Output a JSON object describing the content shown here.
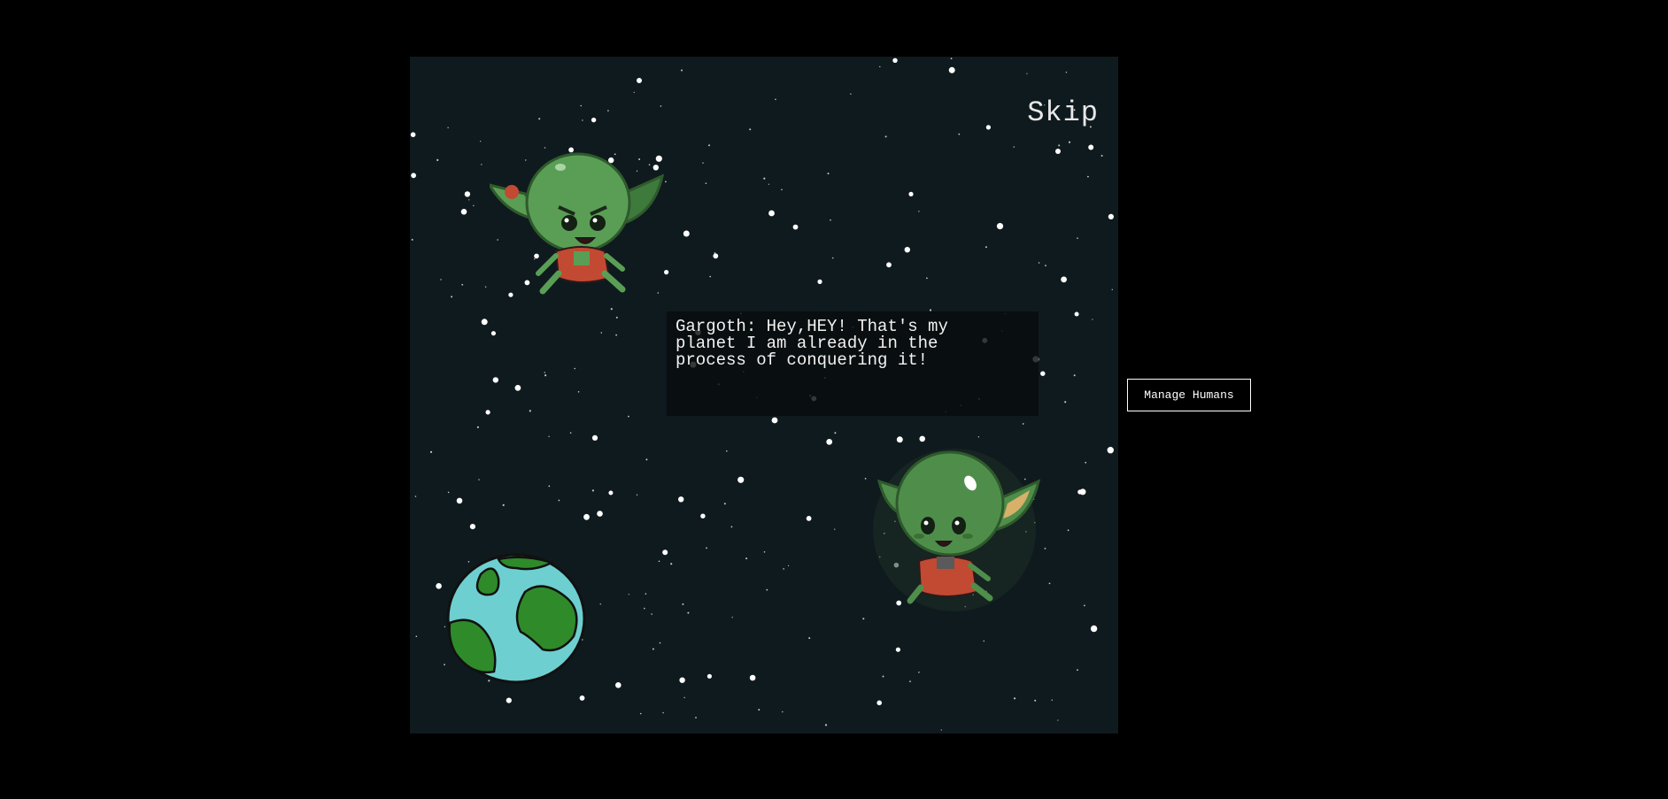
{
  "game": {
    "skip_label": "Skip",
    "dialog": {
      "speaker": "Gargoth",
      "text": "Gargoth: Hey,HEY! That's my planet I am already in the process of conquering it!"
    },
    "characters": [
      {
        "name": "gargoth",
        "role": "angry-alien"
      },
      {
        "name": "friendly-alien",
        "role": "smiling-alien"
      }
    ],
    "planet": "earth",
    "colors": {
      "space_background": "#0f1a1e",
      "page_background": "#000000",
      "alien_green": "#5a9e55",
      "alien_pants": "#c24a32",
      "earth_ocean": "#6ecfd0",
      "earth_land": "#2f8a2a"
    }
  },
  "sidebar": {
    "manage_humans_label": "Manage Humans"
  }
}
